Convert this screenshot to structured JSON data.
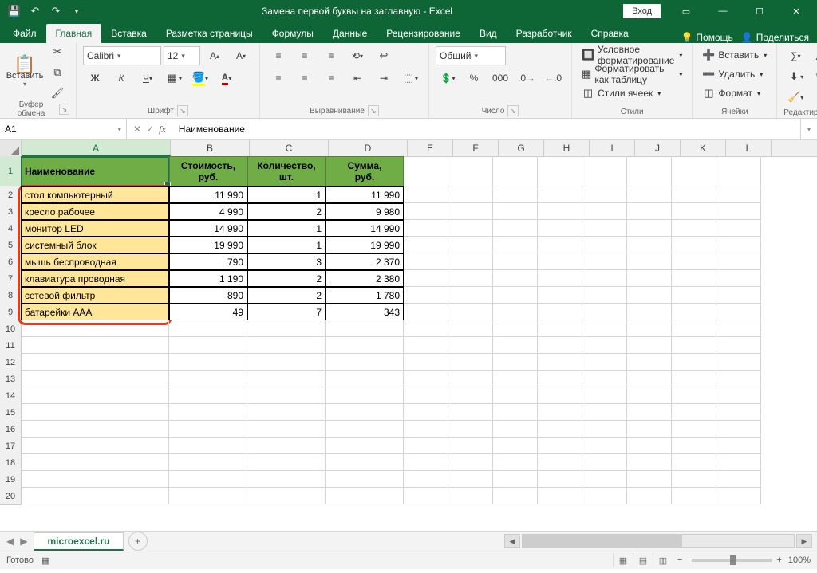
{
  "window": {
    "title": "Замена первой буквы на заглавную - Excel",
    "signin": "Вход"
  },
  "tabs": {
    "file": "Файл",
    "home": "Главная",
    "insert": "Вставка",
    "layout": "Разметка страницы",
    "formulas": "Формулы",
    "data": "Данные",
    "review": "Рецензирование",
    "view": "Вид",
    "developer": "Разработчик",
    "help": "Справка",
    "tellme": "Помощь",
    "share": "Поделиться"
  },
  "ribbon": {
    "clipboard": {
      "paste": "Вставить",
      "label": "Буфер обмена"
    },
    "font": {
      "name": "Calibri",
      "size": "12",
      "label": "Шрифт",
      "bold": "Ж",
      "italic": "К",
      "underline": "Ч"
    },
    "alignment": {
      "label": "Выравнивание"
    },
    "number": {
      "format": "Общий",
      "label": "Число"
    },
    "styles": {
      "cond": "Условное форматирование",
      "table": "Форматировать как таблицу",
      "cell": "Стили ячеек",
      "label": "Стили"
    },
    "cells": {
      "insert": "Вставить",
      "delete": "Удалить",
      "format": "Формат",
      "label": "Ячейки"
    },
    "editing": {
      "label": "Редактирование"
    }
  },
  "namebox": "A1",
  "formula": "Наименование",
  "columns": [
    "A",
    "B",
    "C",
    "D",
    "E",
    "F",
    "G",
    "H",
    "I",
    "J",
    "K",
    "L"
  ],
  "headers": {
    "a": "Наименование",
    "b1": "Стоимость,",
    "b2": "руб.",
    "c1": "Количество,",
    "c2": "шт.",
    "d1": "Сумма,",
    "d2": "руб."
  },
  "rows": [
    {
      "n": "стол компьютерный",
      "cost": "11 990",
      "qty": "1",
      "sum": "11 990"
    },
    {
      "n": "кресло рабочее",
      "cost": "4 990",
      "qty": "2",
      "sum": "9 980"
    },
    {
      "n": "монитор LED",
      "cost": "14 990",
      "qty": "1",
      "sum": "14 990"
    },
    {
      "n": "системный блок",
      "cost": "19 990",
      "qty": "1",
      "sum": "19 990"
    },
    {
      "n": "мышь беспроводная",
      "cost": "790",
      "qty": "3",
      "sum": "2 370"
    },
    {
      "n": "клавиатура проводная",
      "cost": "1 190",
      "qty": "2",
      "sum": "2 380"
    },
    {
      "n": "сетевой фильтр",
      "cost": "890",
      "qty": "2",
      "sum": "1 780"
    },
    {
      "n": "батарейки ААА",
      "cost": "49",
      "qty": "7",
      "sum": "343"
    }
  ],
  "sheet": {
    "name": "microexcel.ru"
  },
  "status": {
    "ready": "Готово",
    "zoom": "100%"
  }
}
